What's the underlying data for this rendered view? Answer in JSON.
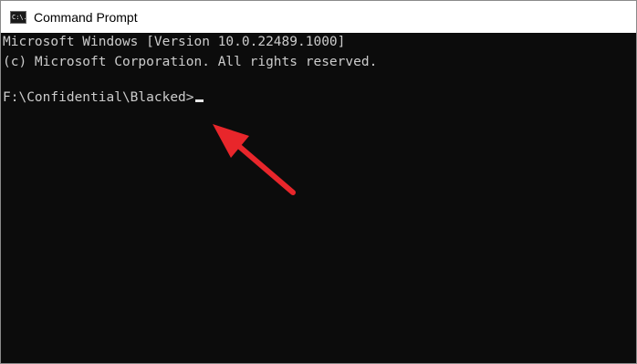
{
  "window": {
    "title": "Command Prompt",
    "icon": "cmd-icon",
    "icon_text": "C:\\."
  },
  "console": {
    "lines": [
      "Microsoft Windows [Version 10.0.22489.1000]",
      "(c) Microsoft Corporation. All rights reserved.",
      "",
      "F:\\Confidential\\Blacked>"
    ],
    "text_color": "#cccccc",
    "background_color": "#0c0c0c"
  },
  "annotation": {
    "type": "arrow",
    "color": "#e8262b",
    "points_to": "cursor"
  }
}
